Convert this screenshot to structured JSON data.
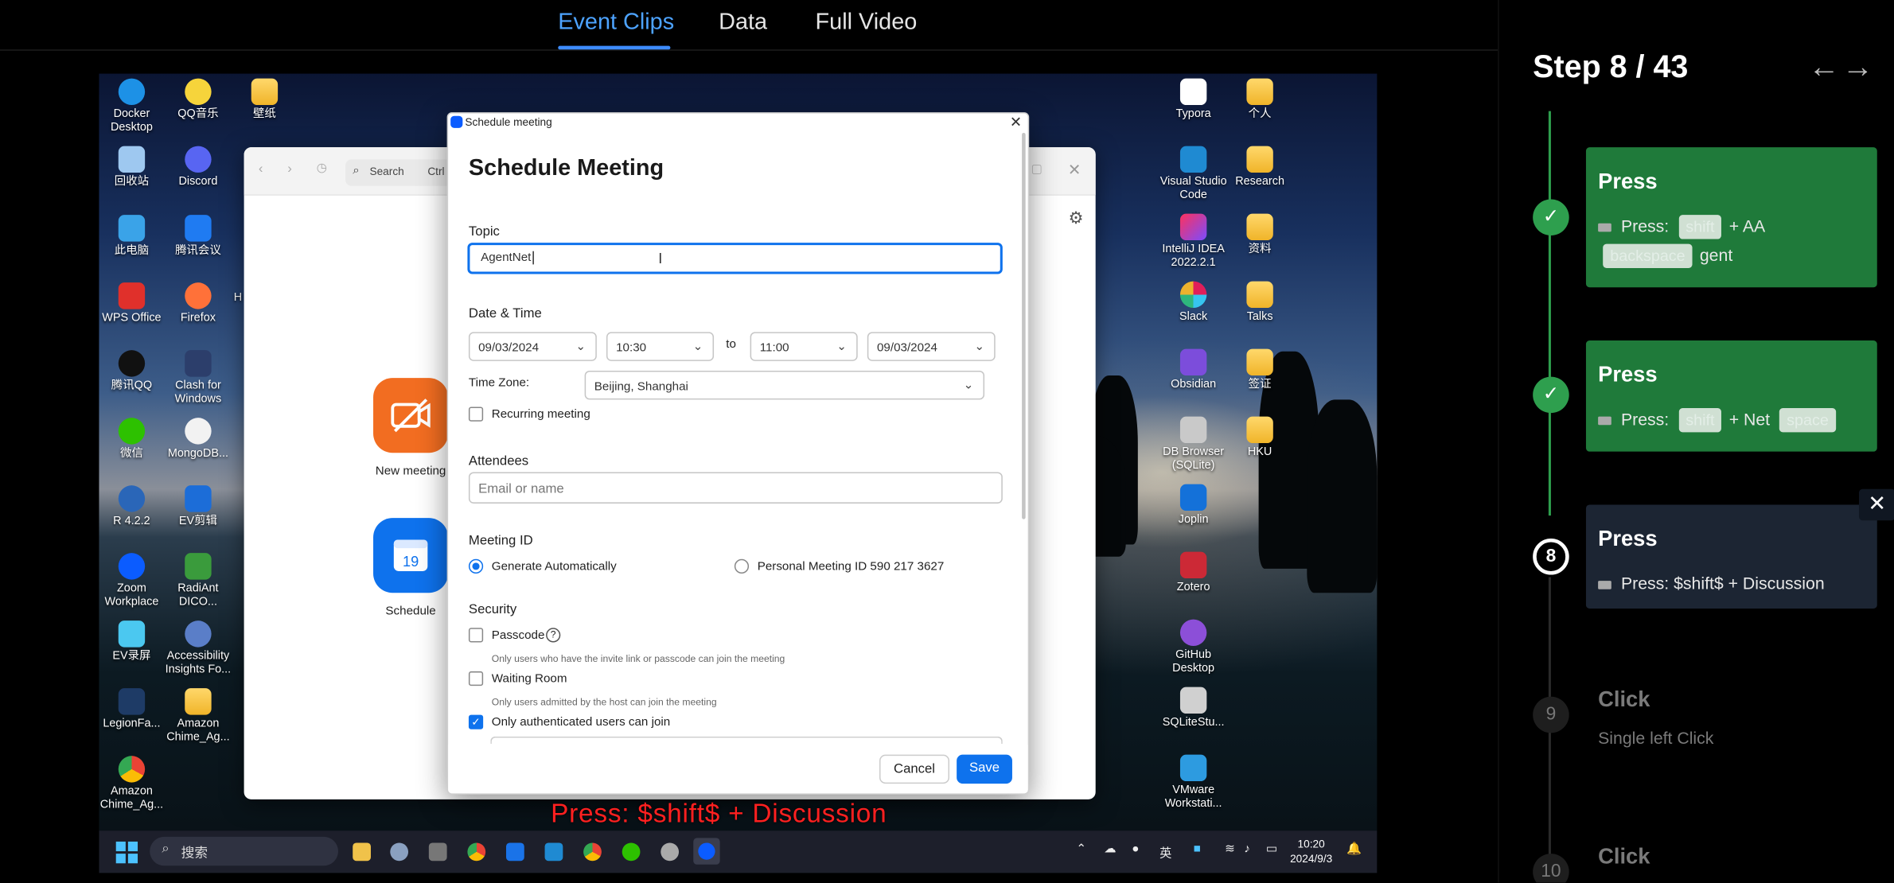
{
  "tabs": [
    {
      "label": "Event Clips",
      "active": true
    },
    {
      "label": "Data",
      "active": false
    },
    {
      "label": "Full Video",
      "active": false
    }
  ],
  "desktop": {
    "left_icons": [
      {
        "label": "Docker Desktop",
        "icon": "docker-icon"
      },
      {
        "label": "QQ音乐",
        "icon": "qq-music-icon"
      },
      {
        "label": "壁纸",
        "icon": "folder-icon"
      },
      {
        "label": "回收站",
        "icon": "recycle-bin-icon"
      },
      {
        "label": "Discord",
        "icon": "discord-icon"
      },
      {
        "label": "此电脑",
        "icon": "computer-icon"
      },
      {
        "label": "腾讯会议",
        "icon": "tencent-meeting-icon"
      },
      {
        "label": "WPS Office",
        "icon": "wps-icon"
      },
      {
        "label": "Firefox",
        "icon": "firefox-icon"
      },
      {
        "label": "腾讯QQ",
        "icon": "qq-icon"
      },
      {
        "label": "Clash for Windows",
        "icon": "clash-icon"
      },
      {
        "label": "微信",
        "icon": "wechat-icon"
      },
      {
        "label": "MongoDB...",
        "icon": "mongodb-icon"
      },
      {
        "label": "R 4.2.2",
        "icon": "r-icon"
      },
      {
        "label": "EV剪辑",
        "icon": "ev-edit-icon"
      },
      {
        "label": "Zoom Workplace",
        "icon": "zoom-icon"
      },
      {
        "label": "RadiAnt DICO...",
        "icon": "radiant-icon"
      },
      {
        "label": "EV录屏",
        "icon": "ev-record-icon"
      },
      {
        "label": "Accessibility Insights Fo...",
        "icon": "accessibility-icon"
      },
      {
        "label": "LegionFa...",
        "icon": "legion-icon"
      },
      {
        "label": "Amazon Chime_Ag...",
        "icon": "folder-icon"
      },
      {
        "label": "Amazon Chime_Ag...",
        "icon": "chrome-icon"
      }
    ],
    "right_icons": [
      {
        "label": "Typora",
        "icon": "typora-icon"
      },
      {
        "label": "个人",
        "icon": "folder-icon"
      },
      {
        "label": "Visual Studio Code",
        "icon": "vscode-icon"
      },
      {
        "label": "Research",
        "icon": "folder-icon"
      },
      {
        "label": "IntelliJ IDEA 2022.2.1",
        "icon": "intellij-icon"
      },
      {
        "label": "资料",
        "icon": "folder-icon"
      },
      {
        "label": "Slack",
        "icon": "slack-icon"
      },
      {
        "label": "Talks",
        "icon": "folder-icon"
      },
      {
        "label": "Obsidian",
        "icon": "obsidian-icon"
      },
      {
        "label": "签证",
        "icon": "folder-icon"
      },
      {
        "label": "DB Browser (SQLite)",
        "icon": "db-browser-icon"
      },
      {
        "label": "HKU",
        "icon": "folder-icon"
      },
      {
        "label": "Joplin",
        "icon": "joplin-icon"
      },
      {
        "label": "Zotero",
        "icon": "zotero-icon"
      },
      {
        "label": "GitHub Desktop",
        "icon": "github-icon"
      },
      {
        "label": "SQLiteStu...",
        "icon": "sqlite-studio-icon"
      },
      {
        "label": "VMware Workstati...",
        "icon": "vmware-icon"
      }
    ],
    "partial_label": "H"
  },
  "zoom_window": {
    "search_label": "Search",
    "search_shortcut": "Ctrl",
    "new_meeting_label": "New meeting",
    "schedule_label": "Schedule",
    "schedule_day": "19"
  },
  "dialog": {
    "window_title": "Schedule meeting",
    "heading": "Schedule Meeting",
    "topic_label": "Topic",
    "topic_value": "AgentNet",
    "datetime_label": "Date & Time",
    "start_date": "09/03/2024",
    "start_time": "10:30",
    "to_label": "to",
    "end_time": "11:00",
    "end_date": "09/03/2024",
    "timezone_label": "Time Zone:",
    "timezone_value": "Beijing, Shanghai",
    "recurring_label": "Recurring meeting",
    "attendees_label": "Attendees",
    "attendees_placeholder": "Email or name",
    "meeting_id_label": "Meeting ID",
    "generate_auto_label": "Generate Automatically",
    "personal_id_label": "Personal Meeting ID 590 217 3627",
    "security_label": "Security",
    "passcode_label": "Passcode",
    "passcode_hint": "Only users who have the invite link or passcode can join the meeting",
    "waiting_room_label": "Waiting Room",
    "waiting_room_hint": "Only users admitted by the host can join the meeting",
    "auth_label": "Only authenticated users can join",
    "cancel_label": "Cancel",
    "save_label": "Save"
  },
  "caption": "Press: $shift$ + Discussion",
  "taskbar": {
    "search_placeholder": "搜索",
    "ime": "英",
    "time": "10:20",
    "date": "2024/9/3"
  },
  "panel": {
    "step_title": "Step 8 / 43",
    "steps": [
      {
        "title": "Press",
        "status": "done",
        "desc_prefix": "Press:",
        "key1": "shift",
        "mid": "+ AA",
        "key2": "backspace",
        "suffix": "gent"
      },
      {
        "title": "Press",
        "status": "done",
        "desc_prefix": "Press:",
        "key1": "shift",
        "mid": "+ Net",
        "key2": "space"
      },
      {
        "number": "8",
        "title": "Press",
        "status": "current",
        "desc": "Press: $shift$ + Discussion"
      },
      {
        "number": "9",
        "title": "Click",
        "status": "todo",
        "desc": "Single left Click"
      },
      {
        "number": "10",
        "title": "Click",
        "status": "todo"
      }
    ]
  },
  "colors": {
    "accent_blue": "#4da3ff",
    "done_green": "#1f7a3a",
    "current_card": "#1c2533",
    "caption_red": "#ff2020",
    "zoom_blue": "#0e72ed"
  }
}
